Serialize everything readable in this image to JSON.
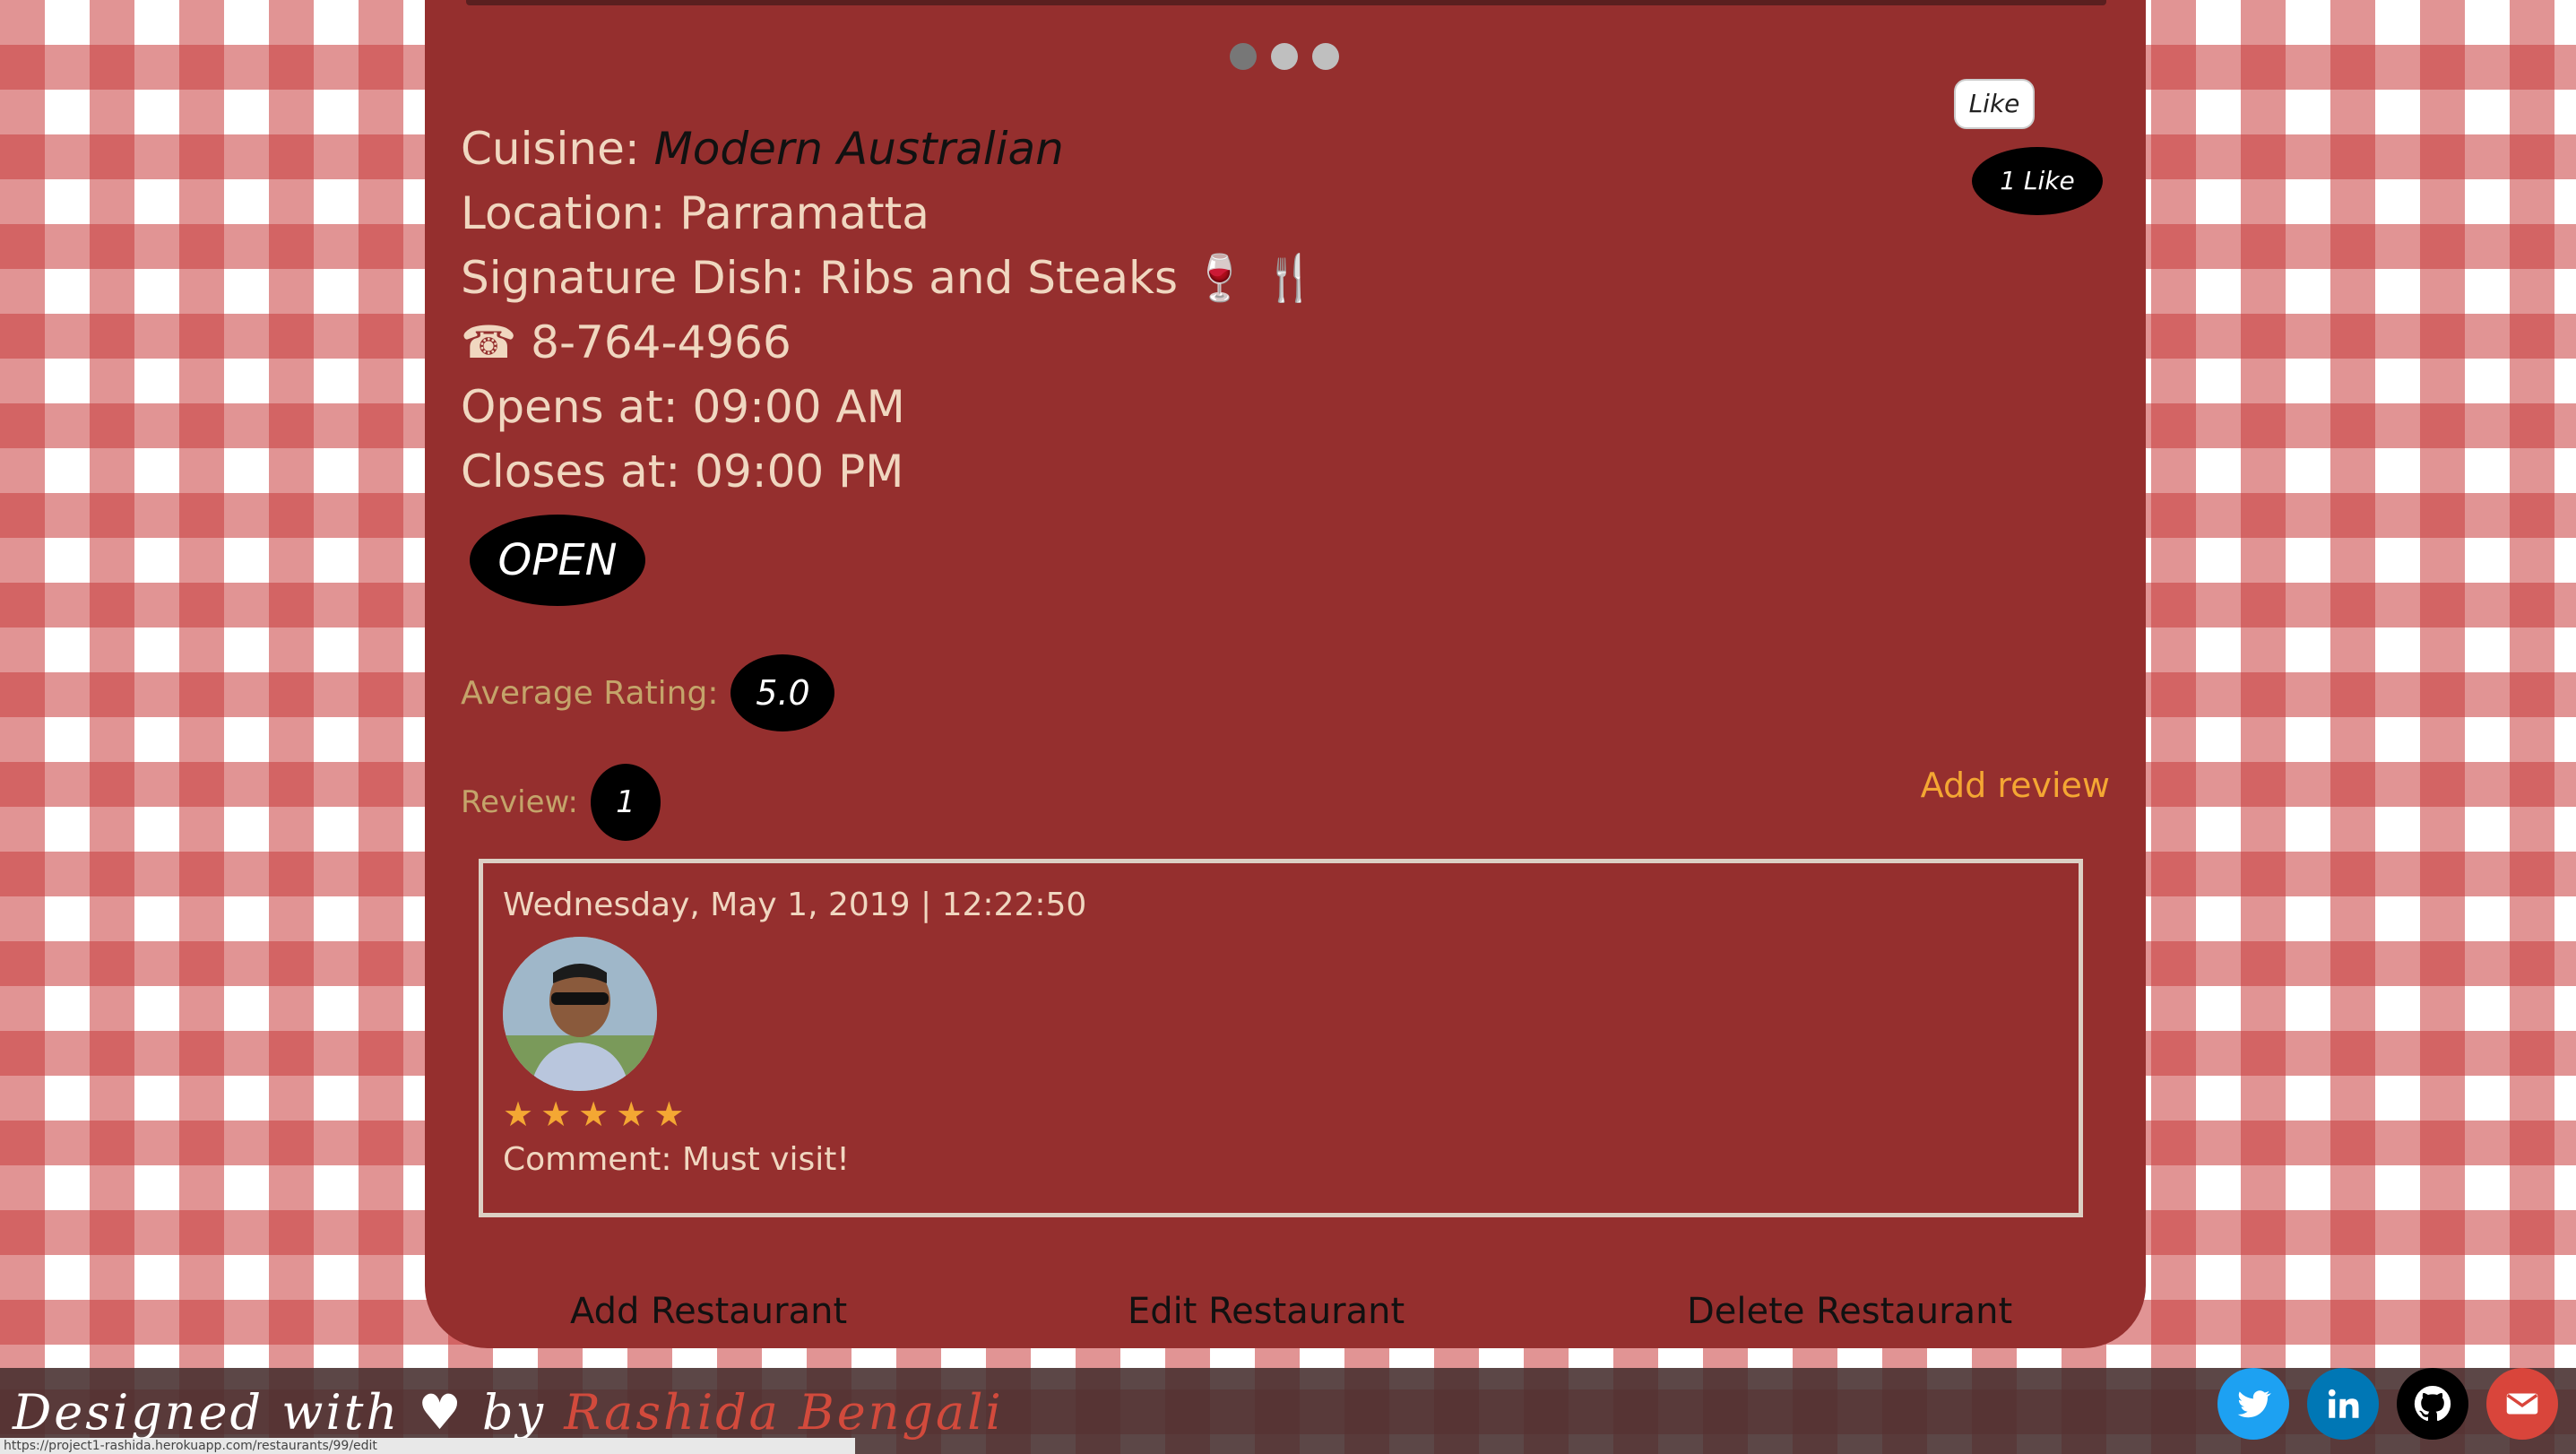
{
  "carousel": {
    "dots": 3,
    "active": 0
  },
  "restaurant": {
    "cuisine_label": "Cuisine:",
    "cuisine_value": "Modern Australian",
    "location": "Location: Parramatta",
    "signature_dish": "Signature Dish: Ribs and Steaks 🍷 🍴",
    "phone": "☎ 8-764-4966",
    "opens": "Opens at: 09:00 AM",
    "closes": "Closes at: 09:00 PM",
    "status": "OPEN"
  },
  "likes": {
    "button_label": "Like",
    "count_label": "1 Like"
  },
  "rating": {
    "label": "Average Rating:",
    "value": "5.0"
  },
  "reviews": {
    "label": "Review:",
    "count": "1",
    "add_label": "Add review",
    "items": [
      {
        "date": "Wednesday, May 1, 2019 | 12:22:50",
        "stars": 5,
        "comment": "Comment: Must visit!"
      }
    ]
  },
  "actions": {
    "add": "Add Restaurant",
    "edit": "Edit Restaurant",
    "delete": "Delete Restaurant"
  },
  "footer": {
    "text_prefix": "Designed with ♥ by",
    "author": "Rashida Bengali",
    "status_url": "https://project1-rashida.herokuapp.com/restaurants/99/edit"
  },
  "colors": {
    "card": "#952f2e",
    "accent": "#f4a733",
    "label": "#c4a46a",
    "twitter": "#1da1f2",
    "linkedin": "#0077b5",
    "github": "#000000",
    "email": "#d9453b"
  },
  "social_icons": [
    "twitter-icon",
    "linkedin-icon",
    "github-icon",
    "email-icon"
  ]
}
